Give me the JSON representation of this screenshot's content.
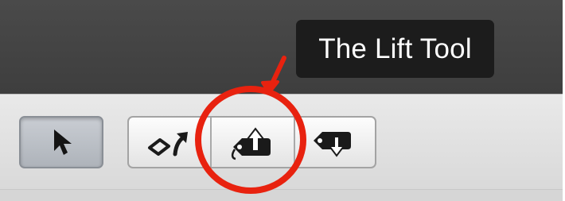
{
  "tooltip": {
    "text": "The Lift Tool"
  },
  "toolbar": {
    "tools": [
      {
        "name": "select-arrow",
        "icon": "pointer-arrow-icon",
        "state": "selected"
      },
      {
        "name": "rotate",
        "icon": "rotate-icon"
      },
      {
        "name": "lift",
        "icon": "lift-tool-icon"
      },
      {
        "name": "stamp",
        "icon": "stamp-tool-icon"
      }
    ]
  },
  "annotation": {
    "color": "#e8220f",
    "target": "lift-tool-button"
  }
}
